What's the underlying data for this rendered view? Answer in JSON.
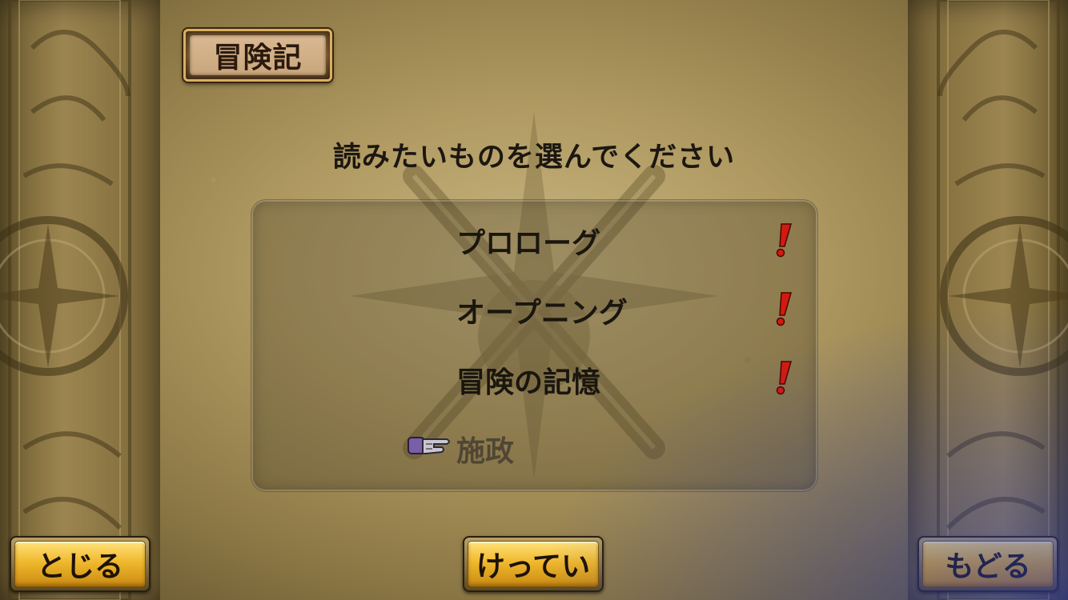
{
  "title": "冒険記",
  "prompt": "読みたいものを選んでください",
  "menu": {
    "items": [
      {
        "label": "プロローグ",
        "new": true
      },
      {
        "label": "オープニング",
        "new": true
      },
      {
        "label": "冒険の記憶",
        "new": true
      },
      {
        "label": "施政",
        "new": false,
        "selected": true
      }
    ]
  },
  "buttons": {
    "close": "とじる",
    "confirm": "けってい",
    "back": "もどる"
  },
  "colors": {
    "button_gold": "#f0b92e",
    "exclaim_red": "#d41a0e",
    "text_dark": "#1a160f"
  }
}
